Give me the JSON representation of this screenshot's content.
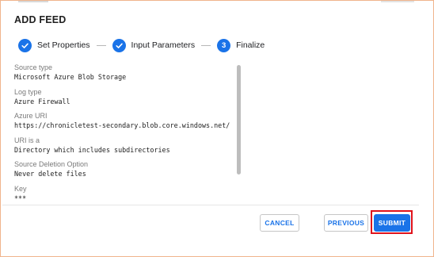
{
  "dialog": {
    "title": "ADD FEED"
  },
  "stepper": {
    "steps": [
      {
        "label": "Set Properties",
        "state": "complete",
        "icon": "check-icon"
      },
      {
        "label": "Input Parameters",
        "state": "complete",
        "icon": "check-icon"
      },
      {
        "label": "Finalize",
        "state": "current",
        "number": "3"
      }
    ]
  },
  "fields": [
    {
      "label": "Source type",
      "value": "Microsoft Azure Blob Storage"
    },
    {
      "label": "Log type",
      "value": "Azure Firewall"
    },
    {
      "label": "Azure URI",
      "value": "https://chronicletest-secondary.blob.core.windows.net/"
    },
    {
      "label": "URI is a",
      "value": "Directory which includes subdirectories"
    },
    {
      "label": "Source Deletion Option",
      "value": "Never delete files"
    },
    {
      "label": "Key",
      "value": "***"
    }
  ],
  "buttons": {
    "cancel": "CANCEL",
    "previous": "PREVIOUS",
    "submit": "SUBMIT"
  },
  "colors": {
    "accent": "#1a73e8",
    "highlight": "#e0131c"
  }
}
